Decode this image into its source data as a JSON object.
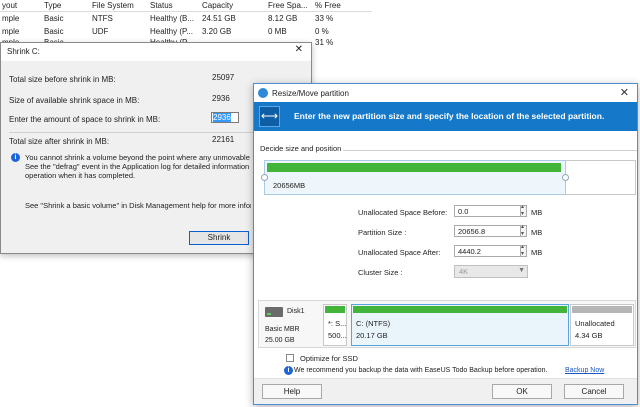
{
  "disk_table": {
    "columns": [
      "yout",
      "Type",
      "File System",
      "Status",
      "Capacity",
      "Free Spa...",
      "% Free"
    ],
    "rows": [
      [
        "mple",
        "Basic",
        "NTFS",
        "Healthy (B...",
        "24.51 GB",
        "8.12 GB",
        "33 %"
      ],
      [
        "mple",
        "Basic",
        "UDF",
        "Healthy (P...",
        "3.20 GB",
        "0 MB",
        "0 %"
      ],
      [
        "mple",
        "Basic",
        "",
        "Healthy (P...",
        "",
        "",
        "31 %"
      ]
    ]
  },
  "shrink_dialog": {
    "title": "Shrink C:",
    "close_glyph": "✕",
    "fields": [
      {
        "label": "Total size before shrink in MB:",
        "value": "25097"
      },
      {
        "label": "Size of available shrink space in MB:",
        "value": "2936"
      },
      {
        "label": "Enter the amount of space to shrink in MB:",
        "value": "2936"
      },
      {
        "label": "Total size after shrink in MB:",
        "value": "22161"
      }
    ],
    "info_icon": "i",
    "note_lines": [
      "You cannot shrink a volume beyond the point where any unmovable f",
      "See the \"defrag\" event in the Application log for detailed information a",
      "operation when it has completed."
    ],
    "help_text": "See \"Shrink a basic volume\" in Disk Management help for more inform",
    "shrink_button": "Shrink"
  },
  "resize_dialog": {
    "title": "Resize/Move partition",
    "close_glyph": "✕",
    "banner_text": "Enter the new partition size and specify the location of the selected partition.",
    "banner_icon": "⟷",
    "group_label": "Decide size and position",
    "track_size": "20656MB",
    "fields": [
      {
        "label": "Unallocated Space Before:",
        "value": "0.0",
        "unit": "MB"
      },
      {
        "label": "Partition Size :",
        "value": "20656.8",
        "unit": "MB"
      },
      {
        "label": "Unallocated Space After:",
        "value": "4440.2",
        "unit": "MB"
      }
    ],
    "cluster_label": "Cluster Size :",
    "cluster_value": "4K",
    "disk": {
      "name": "Disk1",
      "type": "Basic MBR",
      "size": "25.00 GB",
      "partitions": [
        {
          "name": "*: S...",
          "size": "500..."
        },
        {
          "name": "C: (NTFS)",
          "size": "20.17 GB"
        },
        {
          "name": "Unallocated",
          "size": "4.34 GB"
        }
      ]
    },
    "optimize_label": "Optimize for SSD",
    "recommend_text": "We recommend you backup the data with EaseUS Todo Backup before operation.",
    "backup_link": "Backup Now",
    "help_button": "Help",
    "ok_button": "OK",
    "cancel_button": "Cancel"
  },
  "colors": {
    "accent_blue": "#1578c9",
    "partition_green": "#43b43a",
    "link_blue": "#1a56c4"
  }
}
